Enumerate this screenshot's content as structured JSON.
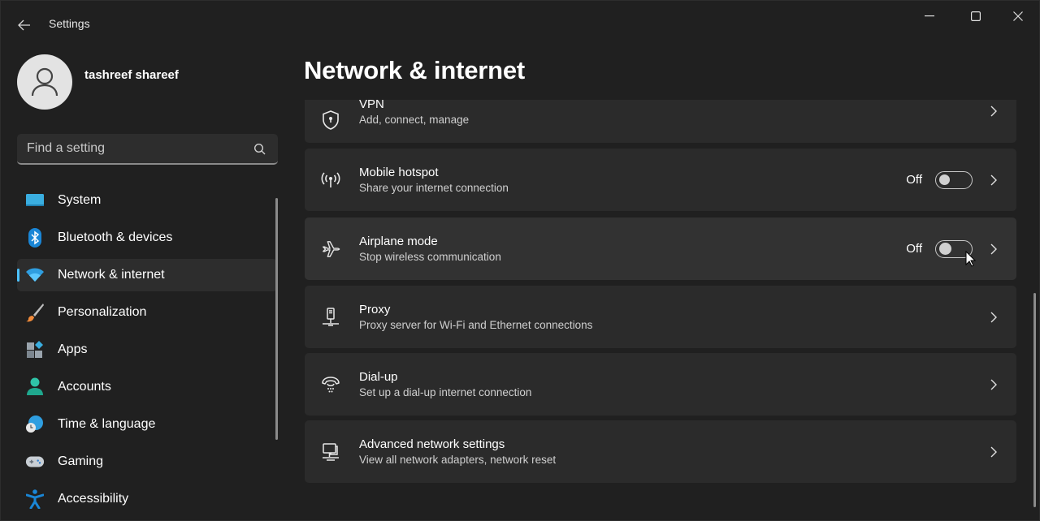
{
  "window": {
    "title": "Settings",
    "controls": [
      "minimize",
      "maximize",
      "close"
    ]
  },
  "profile": {
    "name": "tashreef shareef"
  },
  "search": {
    "placeholder": "Find a setting",
    "value": ""
  },
  "sidebar": {
    "items": [
      {
        "label": "System",
        "icon": "system-icon",
        "active": false
      },
      {
        "label": "Bluetooth & devices",
        "icon": "bluetooth-icon",
        "active": false
      },
      {
        "label": "Network & internet",
        "icon": "wifi-icon",
        "active": true
      },
      {
        "label": "Personalization",
        "icon": "brush-icon",
        "active": false
      },
      {
        "label": "Apps",
        "icon": "apps-icon",
        "active": false
      },
      {
        "label": "Accounts",
        "icon": "accounts-icon",
        "active": false
      },
      {
        "label": "Time & language",
        "icon": "time-language-icon",
        "active": false
      },
      {
        "label": "Gaming",
        "icon": "gamepad-icon",
        "active": false
      },
      {
        "label": "Accessibility",
        "icon": "accessibility-icon",
        "active": false
      }
    ]
  },
  "main": {
    "title": "Network & internet",
    "cards": [
      {
        "title": "VPN",
        "subtitle": "Add, connect, manage",
        "icon": "vpn-shield-icon"
      },
      {
        "title": "Mobile hotspot",
        "subtitle": "Share your internet connection",
        "icon": "hotspot-icon",
        "toggle_state": "Off",
        "toggle_on": false
      },
      {
        "title": "Airplane mode",
        "subtitle": "Stop wireless communication",
        "icon": "airplane-icon",
        "toggle_state": "Off",
        "toggle_on": false
      },
      {
        "title": "Proxy",
        "subtitle": "Proxy server for Wi-Fi and Ethernet connections",
        "icon": "proxy-icon"
      },
      {
        "title": "Dial-up",
        "subtitle": "Set up a dial-up internet connection",
        "icon": "dialup-icon"
      },
      {
        "title": "Advanced network settings",
        "subtitle": "View all network adapters, network reset",
        "icon": "advanced-network-icon"
      }
    ]
  },
  "colors": {
    "accent": "#4cc2ff",
    "background": "#202020",
    "card": "#2b2b2b"
  }
}
